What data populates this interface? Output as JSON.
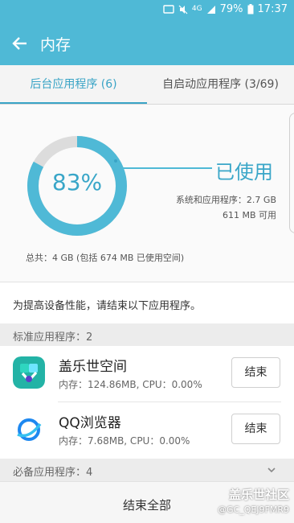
{
  "status": {
    "network": "4G",
    "battery": "79%",
    "time": "17:37"
  },
  "header": {
    "title": "内存"
  },
  "tabs": [
    {
      "label": "后台应用程序 (6)"
    },
    {
      "label": "自启动应用程序 (3/69)"
    }
  ],
  "memory": {
    "percent": "83%",
    "used_fraction": 0.83,
    "used_label": "已使用",
    "system_line": "系统和应用程序：2.7 GB",
    "available_line": "611 MB 可用",
    "total_line": "总共：4 GB (包括 674 MB 已使用空间)"
  },
  "notice": "为提高设备性能，请结束以下应用程序。",
  "standard_section": {
    "label": "标准应用程序：2"
  },
  "apps": [
    {
      "name": "盖乐世空间",
      "info": "内存：124.86MB, CPU：0.00%",
      "button": "结束"
    },
    {
      "name": "QQ浏览器",
      "info": "内存：7.68MB, CPU：0.00%",
      "button": "结束"
    }
  ],
  "required_section": {
    "label": "必备应用程序：4"
  },
  "footer": {
    "end_all": "结束全部"
  },
  "watermark": {
    "line1": "盖乐世社区",
    "line2": "@GC_QEJ9FMR9"
  },
  "colors": {
    "accent": "#4fb9d6",
    "ring_rest": "#dcdcdc"
  }
}
